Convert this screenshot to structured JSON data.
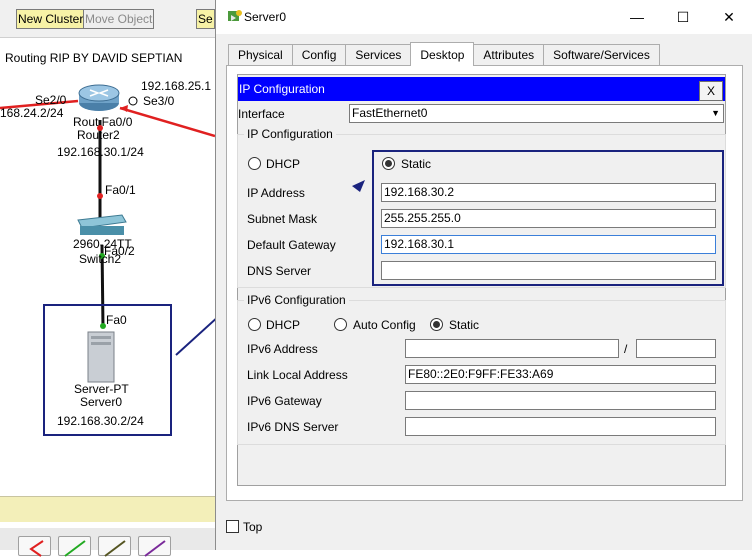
{
  "toolbar": {
    "new_cluster": "New Cluster",
    "move_object": "Move Object",
    "set_partial": "Se"
  },
  "canvas": {
    "title": "Routing RIP BY DAVID SEPTIAN",
    "labels": {
      "ip_25": "192.168.25.1",
      "se3": "Se3/0",
      "se2": "Se2/0",
      "ip_24": "168.24.2/24",
      "router_fa": "Rout Fa0/0",
      "router_name": "Router2",
      "router_ip": "192.168.30.1/24",
      "fa01": "Fa0/1",
      "switch_model": "2960-24TT",
      "switch_fa02": "Fa0/2",
      "switch_name": "Switch2",
      "fa0": "Fa0",
      "server_type": "Server-PT",
      "server_name": "Server0",
      "server_ip": "192.168.30.2/24"
    }
  },
  "window": {
    "title": "Server0",
    "controls": {
      "minimize": "—",
      "maximize": "☐",
      "close": "✕"
    },
    "tabs": [
      "Physical",
      "Config",
      "Services",
      "Desktop",
      "Attributes",
      "Software/Services"
    ],
    "active_tab": "Desktop"
  },
  "ip_config": {
    "header": "IP Configuration",
    "close": "X",
    "interface_label": "Interface",
    "interface_value": "FastEthernet0",
    "ipv4_group": "IP Configuration",
    "dhcp": "DHCP",
    "static": "Static",
    "ipv4_mode": "Static",
    "ip_address_label": "IP Address",
    "ip_address": "192.168.30.2",
    "subnet_label": "Subnet Mask",
    "subnet": "255.255.255.0",
    "gateway_label": "Default Gateway",
    "gateway": "192.168.30.1",
    "dns_label": "DNS Server",
    "dns": "",
    "ipv6_group": "IPv6 Configuration",
    "ipv6_dhcp": "DHCP",
    "ipv6_auto": "Auto Config",
    "ipv6_static": "Static",
    "ipv6_mode": "Static",
    "ipv6_address_label": "IPv6 Address",
    "ipv6_address": "",
    "ipv6_slash": "/",
    "ipv6_prefix": "",
    "link_local_label": "Link Local Address",
    "link_local": "FE80::2E0:F9FF:FE33:A69",
    "ipv6_gateway_label": "IPv6 Gateway",
    "ipv6_gateway": "",
    "ipv6_dns_label": "IPv6 DNS Server",
    "ipv6_dns": ""
  },
  "footer": {
    "top_label": "Top",
    "top_checked": false
  },
  "colors": {
    "header_blue": "#0000ff",
    "highlight_navy": "#1a237e",
    "link_red": "#e02020",
    "link_green": "#22aa22"
  }
}
